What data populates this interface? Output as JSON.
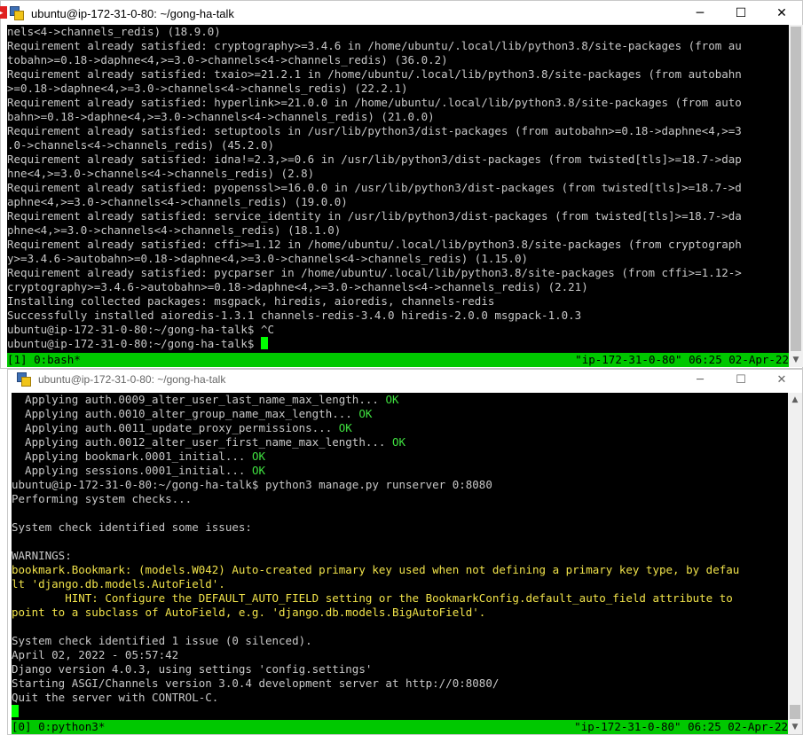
{
  "window1": {
    "title": "ubuntu@ip-172-31-0-80: ~/gong-ha-talk",
    "controls": {
      "minimize": "─",
      "maximize": "☐",
      "close": "✕"
    },
    "lines": [
      [
        {
          "t": "nels<4->channels_redis) (18.9.0)"
        }
      ],
      [
        {
          "t": "Requirement already satisfied: cryptography>=3.4.6 in /home/ubuntu/.local/lib/python3.8/site-packages (from au"
        }
      ],
      [
        {
          "t": "tobahn>=0.18->daphne<4,>=3.0->channels<4->channels_redis) (36.0.2)"
        }
      ],
      [
        {
          "t": "Requirement already satisfied: txaio>=21.2.1 in /home/ubuntu/.local/lib/python3.8/site-packages (from autobahn"
        }
      ],
      [
        {
          "t": ">=0.18->daphne<4,>=3.0->channels<4->channels_redis) (22.2.1)"
        }
      ],
      [
        {
          "t": "Requirement already satisfied: hyperlink>=21.0.0 in /home/ubuntu/.local/lib/python3.8/site-packages (from auto"
        }
      ],
      [
        {
          "t": "bahn>=0.18->daphne<4,>=3.0->channels<4->channels_redis) (21.0.0)"
        }
      ],
      [
        {
          "t": "Requirement already satisfied: setuptools in /usr/lib/python3/dist-packages (from autobahn>=0.18->daphne<4,>=3"
        }
      ],
      [
        {
          "t": ".0->channels<4->channels_redis) (45.2.0)"
        }
      ],
      [
        {
          "t": "Requirement already satisfied: idna!=2.3,>=0.6 in /usr/lib/python3/dist-packages (from twisted[tls]>=18.7->dap"
        }
      ],
      [
        {
          "t": "hne<4,>=3.0->channels<4->channels_redis) (2.8)"
        }
      ],
      [
        {
          "t": "Requirement already satisfied: pyopenssl>=16.0.0 in /usr/lib/python3/dist-packages (from twisted[tls]>=18.7->d"
        }
      ],
      [
        {
          "t": "aphne<4,>=3.0->channels<4->channels_redis) (19.0.0)"
        }
      ],
      [
        {
          "t": "Requirement already satisfied: service_identity in /usr/lib/python3/dist-packages (from twisted[tls]>=18.7->da"
        }
      ],
      [
        {
          "t": "phne<4,>=3.0->channels<4->channels_redis) (18.1.0)"
        }
      ],
      [
        {
          "t": "Requirement already satisfied: cffi>=1.12 in /home/ubuntu/.local/lib/python3.8/site-packages (from cryptograph"
        }
      ],
      [
        {
          "t": "y>=3.4.6->autobahn>=0.18->daphne<4,>=3.0->channels<4->channels_redis) (1.15.0)"
        }
      ],
      [
        {
          "t": "Requirement already satisfied: pycparser in /home/ubuntu/.local/lib/python3.8/site-packages (from cffi>=1.12->"
        }
      ],
      [
        {
          "t": "cryptography>=3.4.6->autobahn>=0.18->daphne<4,>=3.0->channels<4->channels_redis) (2.21)"
        }
      ],
      [
        {
          "t": "Installing collected packages: msgpack, hiredis, aioredis, channels-redis"
        }
      ],
      [
        {
          "t": "Successfully installed aioredis-1.3.1 channels-redis-3.4.0 hiredis-2.0.0 msgpack-1.0.3"
        }
      ],
      [
        {
          "t": "ubuntu@ip-172-31-0-80:~/gong-ha-talk$ ^C"
        }
      ],
      [
        {
          "t": "ubuntu@ip-172-31-0-80:~/gong-ha-talk$ "
        },
        {
          "cursor": true
        }
      ]
    ],
    "status_left": "[1] 0:bash*",
    "status_right": "\"ip-172-31-0-80\" 06:25 02-Apr-22"
  },
  "window2": {
    "title": "ubuntu@ip-172-31-0-80: ~/gong-ha-talk",
    "controls": {
      "minimize": "─",
      "maximize": "☐",
      "close": "✕"
    },
    "lines": [
      [
        {
          "t": "  Applying auth.0009_alter_user_last_name_max_length... "
        },
        {
          "t": "OK",
          "c": "ok"
        }
      ],
      [
        {
          "t": "  Applying auth.0010_alter_group_name_max_length... "
        },
        {
          "t": "OK",
          "c": "ok"
        }
      ],
      [
        {
          "t": "  Applying auth.0011_update_proxy_permissions... "
        },
        {
          "t": "OK",
          "c": "ok"
        }
      ],
      [
        {
          "t": "  Applying auth.0012_alter_user_first_name_max_length... "
        },
        {
          "t": "OK",
          "c": "ok"
        }
      ],
      [
        {
          "t": "  Applying bookmark.0001_initial... "
        },
        {
          "t": "OK",
          "c": "ok"
        }
      ],
      [
        {
          "t": "  Applying sessions.0001_initial... "
        },
        {
          "t": "OK",
          "c": "ok"
        }
      ],
      [
        {
          "t": "ubuntu@ip-172-31-0-80:~/gong-ha-talk$ python3 manage.py runserver 0:8080"
        }
      ],
      [
        {
          "t": "Performing system checks..."
        }
      ],
      [
        {
          "t": ""
        }
      ],
      [
        {
          "t": "System check identified some issues:"
        }
      ],
      [
        {
          "t": ""
        }
      ],
      [
        {
          "t": "WARNINGS:"
        }
      ],
      [
        {
          "t": "bookmark.Bookmark: (models.W042) Auto-created primary key used when not defining a primary key type, by defau",
          "c": "warn"
        }
      ],
      [
        {
          "t": "lt 'django.db.models.AutoField'.",
          "c": "warn"
        }
      ],
      [
        {
          "t": "        HINT: Configure the DEFAULT_AUTO_FIELD setting or the BookmarkConfig.default_auto_field attribute to",
          "c": "warn"
        }
      ],
      [
        {
          "t": "point to a subclass of AutoField, e.g. 'django.db.models.BigAutoField'.",
          "c": "warn"
        }
      ],
      [
        {
          "t": ""
        }
      ],
      [
        {
          "t": "System check identified 1 issue (0 silenced)."
        }
      ],
      [
        {
          "t": "April 02, 2022 - 05:57:42"
        }
      ],
      [
        {
          "t": "Django version 4.0.3, using settings 'config.settings'"
        }
      ],
      [
        {
          "t": "Starting ASGI/Channels version 3.0.4 development server at http://0:8080/"
        }
      ],
      [
        {
          "t": "Quit the server with CONTROL-C."
        }
      ],
      [
        {
          "cursor": true
        }
      ]
    ],
    "status_left": "[0] 0:python3*",
    "status_right": "\"ip-172-31-0-80\" 06:25 02-Apr-22"
  }
}
